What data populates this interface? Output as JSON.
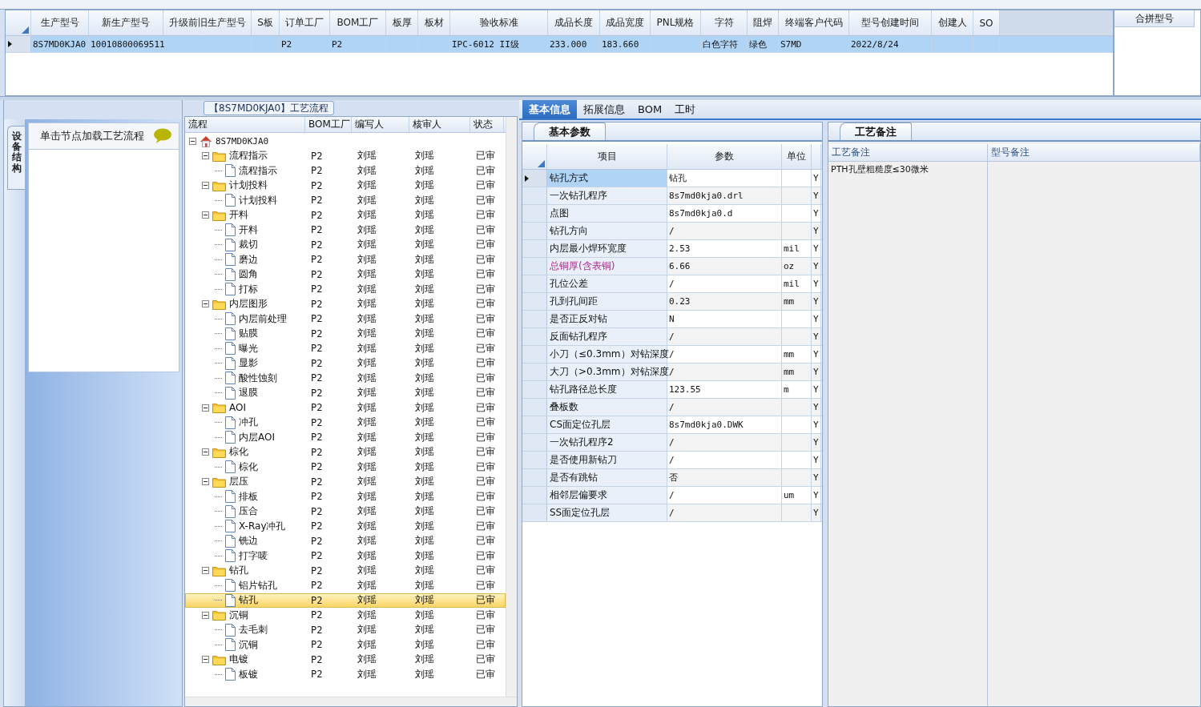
{
  "top_grid": {
    "columns": [
      "生产型号",
      "新生产型号",
      "升级前旧生产型号",
      "S板",
      "订单工厂",
      "BOM工厂",
      "板厚",
      "板材",
      "验收标准",
      "成品长度",
      "成品宽度",
      "PNL规格",
      "字符",
      "阻焊",
      "终端客户代码",
      "型号创建时间",
      "创建人",
      "SO"
    ],
    "rows": [
      {
        "selected": true,
        "cells": [
          "8S7MD0KJA0",
          "10010800069511",
          null,
          null,
          "P2",
          "P2",
          null,
          null,
          "IPC-6012 II级",
          "233.000",
          "183.660",
          null,
          "白色字符",
          "绿色",
          "S7MD",
          "2022/8/24",
          null,
          null
        ]
      }
    ]
  },
  "merge_panel": {
    "title": "合拼型号"
  },
  "side_panel": {
    "tab": "设备结构",
    "hint": "单击节点加载工艺流程"
  },
  "flow_panel": {
    "title": "【8S7MD0KJA0】工艺流程"
  },
  "tree": {
    "columns": [
      "流程",
      "BOM工厂",
      "编写人",
      "核审人",
      "状态"
    ],
    "nodes": [
      {
        "kind": "root",
        "label": "8S7MD0KJA0",
        "expanded": true,
        "selected": false,
        "children": [
          {
            "kind": "folder",
            "label": "流程指示",
            "bom": "P2",
            "writer": "刘瑶",
            "reviewer": "刘瑶",
            "status": "已审",
            "expanded": true,
            "selected": false,
            "children": [
              {
                "kind": "doc",
                "label": "流程指示",
                "bom": "P2",
                "writer": "刘瑶",
                "reviewer": "刘瑶",
                "status": "已审",
                "selected": false
              }
            ]
          },
          {
            "kind": "folder",
            "label": "计划投料",
            "bom": "P2",
            "writer": "刘瑶",
            "reviewer": "刘瑶",
            "status": "已审",
            "expanded": true,
            "selected": false,
            "children": [
              {
                "kind": "doc",
                "label": "计划投料",
                "bom": "P2",
                "writer": "刘瑶",
                "reviewer": "刘瑶",
                "status": "已审",
                "selected": false
              }
            ]
          },
          {
            "kind": "folder",
            "label": "开料",
            "bom": "P2",
            "writer": "刘瑶",
            "reviewer": "刘瑶",
            "status": "已审",
            "expanded": true,
            "selected": false,
            "children": [
              {
                "kind": "doc",
                "label": "开料",
                "bom": "P2",
                "writer": "刘瑶",
                "reviewer": "刘瑶",
                "status": "已审",
                "selected": false
              },
              {
                "kind": "doc",
                "label": "裁切",
                "bom": "P2",
                "writer": "刘瑶",
                "reviewer": "刘瑶",
                "status": "已审",
                "selected": false
              },
              {
                "kind": "doc",
                "label": "磨边",
                "bom": "P2",
                "writer": "刘瑶",
                "reviewer": "刘瑶",
                "status": "已审",
                "selected": false
              },
              {
                "kind": "doc",
                "label": "圆角",
                "bom": "P2",
                "writer": "刘瑶",
                "reviewer": "刘瑶",
                "status": "已审",
                "selected": false
              },
              {
                "kind": "doc",
                "label": "打标",
                "bom": "P2",
                "writer": "刘瑶",
                "reviewer": "刘瑶",
                "status": "已审",
                "selected": false
              }
            ]
          },
          {
            "kind": "folder",
            "label": "内层图形",
            "bom": "P2",
            "writer": "刘瑶",
            "reviewer": "刘瑶",
            "status": "已审",
            "expanded": true,
            "selected": false,
            "children": [
              {
                "kind": "doc",
                "label": "内层前处理",
                "bom": "P2",
                "writer": "刘瑶",
                "reviewer": "刘瑶",
                "status": "已审",
                "selected": false
              },
              {
                "kind": "doc",
                "label": "贴膜",
                "bom": "P2",
                "writer": "刘瑶",
                "reviewer": "刘瑶",
                "status": "已审",
                "selected": false
              },
              {
                "kind": "doc",
                "label": "曝光",
                "bom": "P2",
                "writer": "刘瑶",
                "reviewer": "刘瑶",
                "status": "已审",
                "selected": false
              },
              {
                "kind": "doc",
                "label": "显影",
                "bom": "P2",
                "writer": "刘瑶",
                "reviewer": "刘瑶",
                "status": "已审",
                "selected": false
              },
              {
                "kind": "doc",
                "label": "酸性蚀刻",
                "bom": "P2",
                "writer": "刘瑶",
                "reviewer": "刘瑶",
                "status": "已审",
                "selected": false
              },
              {
                "kind": "doc",
                "label": "退膜",
                "bom": "P2",
                "writer": "刘瑶",
                "reviewer": "刘瑶",
                "status": "已审",
                "selected": false
              }
            ]
          },
          {
            "kind": "folder",
            "label": "AOI",
            "bom": "P2",
            "writer": "刘瑶",
            "reviewer": "刘瑶",
            "status": "已审",
            "expanded": true,
            "selected": false,
            "children": [
              {
                "kind": "doc",
                "label": "冲孔",
                "bom": "P2",
                "writer": "刘瑶",
                "reviewer": "刘瑶",
                "status": "已审",
                "selected": false
              },
              {
                "kind": "doc",
                "label": "内层AOI",
                "bom": "P2",
                "writer": "刘瑶",
                "reviewer": "刘瑶",
                "status": "已审",
                "selected": false
              }
            ]
          },
          {
            "kind": "folder",
            "label": "棕化",
            "bom": "P2",
            "writer": "刘瑶",
            "reviewer": "刘瑶",
            "status": "已审",
            "expanded": true,
            "selected": false,
            "children": [
              {
                "kind": "doc",
                "label": "棕化",
                "bom": "P2",
                "writer": "刘瑶",
                "reviewer": "刘瑶",
                "status": "已审",
                "selected": false
              }
            ]
          },
          {
            "kind": "folder",
            "label": "层压",
            "bom": "P2",
            "writer": "刘瑶",
            "reviewer": "刘瑶",
            "status": "已审",
            "expanded": true,
            "selected": false,
            "children": [
              {
                "kind": "doc",
                "label": "排板",
                "bom": "P2",
                "writer": "刘瑶",
                "reviewer": "刘瑶",
                "status": "已审",
                "selected": false
              },
              {
                "kind": "doc",
                "label": "压合",
                "bom": "P2",
                "writer": "刘瑶",
                "reviewer": "刘瑶",
                "status": "已审",
                "selected": false
              },
              {
                "kind": "doc",
                "label": "X-Ray冲孔",
                "bom": "P2",
                "writer": "刘瑶",
                "reviewer": "刘瑶",
                "status": "已审",
                "selected": false
              },
              {
                "kind": "doc",
                "label": "铣边",
                "bom": "P2",
                "writer": "刘瑶",
                "reviewer": "刘瑶",
                "status": "已审",
                "selected": false
              },
              {
                "kind": "doc",
                "label": "打字唛",
                "bom": "P2",
                "writer": "刘瑶",
                "reviewer": "刘瑶",
                "status": "已审",
                "selected": false
              }
            ]
          },
          {
            "kind": "folder",
            "label": "钻孔",
            "bom": "P2",
            "writer": "刘瑶",
            "reviewer": "刘瑶",
            "status": "已审",
            "expanded": true,
            "selected": false,
            "children": [
              {
                "kind": "doc",
                "label": "铝片钻孔",
                "bom": "P2",
                "writer": "刘瑶",
                "reviewer": "刘瑶",
                "status": "已审",
                "selected": false
              },
              {
                "kind": "doc",
                "label": "钻孔",
                "bom": "P2",
                "writer": "刘瑶",
                "reviewer": "刘瑶",
                "status": "已审",
                "selected": true
              }
            ]
          },
          {
            "kind": "folder",
            "label": "沉铜",
            "bom": "P2",
            "writer": "刘瑶",
            "reviewer": "刘瑶",
            "status": "已审",
            "expanded": true,
            "selected": false,
            "children": [
              {
                "kind": "doc",
                "label": "去毛刺",
                "bom": "P2",
                "writer": "刘瑶",
                "reviewer": "刘瑶",
                "status": "已审",
                "selected": false
              },
              {
                "kind": "doc",
                "label": "沉铜",
                "bom": "P2",
                "writer": "刘瑶",
                "reviewer": "刘瑶",
                "status": "已审",
                "selected": false
              }
            ]
          },
          {
            "kind": "folder",
            "label": "电镀",
            "bom": "P2",
            "writer": "刘瑶",
            "reviewer": "刘瑶",
            "status": "已审",
            "expanded": true,
            "selected": false,
            "children": [
              {
                "kind": "doc",
                "label": "板镀",
                "bom": "P2",
                "writer": "刘瑶",
                "reviewer": "刘瑶",
                "status": "已审",
                "selected": false
              }
            ]
          }
        ]
      }
    ]
  },
  "tabs": [
    {
      "label": "基本信息",
      "selected": true
    },
    {
      "label": "拓展信息",
      "selected": false
    },
    {
      "label": "BOM",
      "selected": false
    },
    {
      "label": "工时",
      "selected": false
    }
  ],
  "params_panel": {
    "tab": "基本参数",
    "columns": [
      "项目",
      "参数",
      "单位"
    ],
    "rows": [
      {
        "name": "钻孔方式",
        "value": "钻孔",
        "unit": null,
        "flag": "Y",
        "selected": true,
        "flagged": false
      },
      {
        "name": "一次钻孔程序",
        "value": "8s7md0kja0.drl",
        "unit": null,
        "flag": "Y",
        "selected": false,
        "flagged": false
      },
      {
        "name": "点图",
        "value": "8s7md0kja0.d",
        "unit": null,
        "flag": "Y",
        "selected": false,
        "flagged": false
      },
      {
        "name": "钻孔方向",
        "value": "/",
        "unit": null,
        "flag": "Y",
        "selected": false,
        "flagged": false
      },
      {
        "name": "内层最小焊环宽度",
        "value": "2.53",
        "unit": "mil",
        "flag": "Y",
        "selected": false,
        "flagged": false
      },
      {
        "name": "总铜厚(含表铜)",
        "value": "6.66",
        "unit": "oz",
        "flag": "Y",
        "selected": false,
        "flagged": true
      },
      {
        "name": "孔位公差",
        "value": "/",
        "unit": "mil",
        "flag": "Y",
        "selected": false,
        "flagged": false
      },
      {
        "name": "孔到孔间距",
        "value": "0.23",
        "unit": "mm",
        "flag": "Y",
        "selected": false,
        "flagged": false
      },
      {
        "name": "是否正反对钻",
        "value": "N",
        "unit": null,
        "flag": "Y",
        "selected": false,
        "flagged": false
      },
      {
        "name": "反面钻孔程序",
        "value": "/",
        "unit": null,
        "flag": "Y",
        "selected": false,
        "flagged": false
      },
      {
        "name": "小刀（≤0.3mm）对钻深度",
        "value": "/",
        "unit": "mm",
        "flag": "Y",
        "selected": false,
        "flagged": false
      },
      {
        "name": "大刀（>0.3mm）对钻深度",
        "value": "/",
        "unit": "mm",
        "flag": "Y",
        "selected": false,
        "flagged": false
      },
      {
        "name": "钻孔路径总长度",
        "value": "123.55",
        "unit": "m",
        "flag": "Y",
        "selected": false,
        "flagged": false
      },
      {
        "name": "叠板数",
        "value": "/",
        "unit": null,
        "flag": "Y",
        "selected": false,
        "flagged": false
      },
      {
        "name": "CS面定位孔层",
        "value": "8s7md0kja0.DWK",
        "unit": null,
        "flag": "Y",
        "selected": false,
        "flagged": false
      },
      {
        "name": "一次钻孔程序2",
        "value": "/",
        "unit": null,
        "flag": "Y",
        "selected": false,
        "flagged": false
      },
      {
        "name": "是否使用新钻刀",
        "value": "/",
        "unit": null,
        "flag": "Y",
        "selected": false,
        "flagged": false
      },
      {
        "name": "是否有跳钻",
        "value": "否",
        "unit": null,
        "flag": "Y",
        "selected": false,
        "flagged": false
      },
      {
        "name": "相邻层偏要求",
        "value": "/",
        "unit": "um",
        "flag": "Y",
        "selected": false,
        "flagged": false
      },
      {
        "name": "SS面定位孔层",
        "value": "/",
        "unit": null,
        "flag": "Y",
        "selected": false,
        "flagged": false
      }
    ]
  },
  "notes_panel": {
    "tab": "工艺备注",
    "columns": [
      "工艺备注",
      "型号备注"
    ],
    "process_note": "PTH孔壁粗糙度≤30微米"
  }
}
